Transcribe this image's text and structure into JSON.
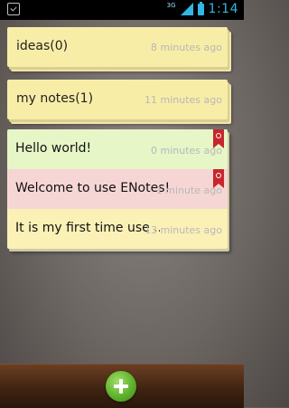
{
  "status_bar": {
    "network_label": "3G",
    "time": "1:14"
  },
  "categories": [
    {
      "label": "ideas(0)",
      "time": "8 minutes ago"
    },
    {
      "label": "my notes(1)",
      "time": "11 minutes ago"
    }
  ],
  "notes": [
    {
      "title": "Hello world!",
      "time": "0 minutes ago",
      "color": "#e6f6c7",
      "alarm": true
    },
    {
      "title": "Welcome to use ENotes!",
      "time": "1 minute ago",
      "color": "#f6d6d4",
      "alarm": true
    },
    {
      "title": "It is my first time use ...",
      "time": "13 minutes ago",
      "color": "#fbf1b6",
      "alarm": false
    }
  ],
  "colors": {
    "accent": "#33b5e5",
    "alarm_flag": "#c6262c",
    "add_button": "#5fb12d"
  },
  "icons": {
    "status_left": "checkbox-icon",
    "add": "plus-circle-icon",
    "alarm": "alarm-flag-icon"
  }
}
